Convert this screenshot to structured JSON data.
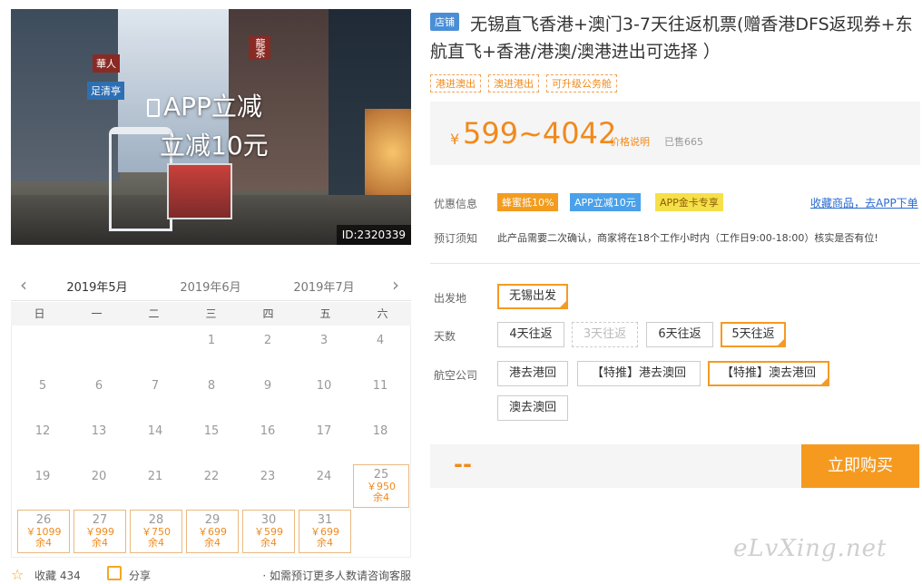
{
  "photo": {
    "overlay_line1": "APP立减",
    "overlay_line2": "立减10元",
    "image_id": "ID:2320339",
    "signs": [
      "足清亭",
      "華人",
      "龍茶"
    ]
  },
  "calendar": {
    "months": [
      "2019年5月",
      "2019年6月",
      "2019年7月"
    ],
    "active_month": "2019年5月",
    "weekdays": [
      "日",
      "一",
      "二",
      "三",
      "四",
      "五",
      "六"
    ],
    "plain_days": [
      "1",
      "2",
      "3",
      "4",
      "5",
      "6",
      "7",
      "8",
      "9",
      "10",
      "11",
      "12",
      "13",
      "14",
      "15",
      "16",
      "17",
      "18",
      "19",
      "20",
      "21",
      "22",
      "23",
      "24"
    ],
    "avail_days": [
      {
        "day": "25",
        "price": "￥950",
        "remain": "余4"
      },
      {
        "day": "26",
        "price": "￥1099",
        "remain": "余4"
      },
      {
        "day": "27",
        "price": "￥999",
        "remain": "余4"
      },
      {
        "day": "28",
        "price": "￥750",
        "remain": "余4"
      },
      {
        "day": "29",
        "price": "￥699",
        "remain": "余4"
      },
      {
        "day": "30",
        "price": "￥599",
        "remain": "余4"
      },
      {
        "day": "31",
        "price": "￥699",
        "remain": "余4"
      }
    ]
  },
  "footer": {
    "favorite_label": "收藏 434",
    "share_label": "分享",
    "tip": "· 如需预订更多人数请咨询客服"
  },
  "product": {
    "shop_tag": "店铺",
    "title": "无锡直飞香港+澳门3-7天往返机票(赠香港DFS返现券+东航直飞+香港/港澳/澳港进出可选择 ）",
    "tags": [
      "港进澳出",
      "澳进港出",
      "可升级公务舱"
    ],
    "price_currency": "¥",
    "price": "599~4042",
    "price_note": "价格说明",
    "sold": "已售665"
  },
  "promo": {
    "label": "优惠信息",
    "items": [
      "蜂蜜抵10%",
      "APP立减10元",
      "APP金卡专享"
    ],
    "fav_link": "收藏商品，去APP下单"
  },
  "notice": {
    "label": "预订须知",
    "text": "此产品需要二次确认，商家将在18个工作小时内（工作日9:00-18:00）核实是否有位!"
  },
  "options": {
    "departure_label": "出发地",
    "departure": [
      "无锡出发"
    ],
    "days_label": "天数",
    "days": [
      "4天往返",
      "3天往返",
      "6天往返",
      "5天往返"
    ],
    "airline_label": "航空公司",
    "airline": [
      "港去港回",
      "【特推】港去澳回",
      "【特推】澳去港回",
      "澳去澳回"
    ]
  },
  "buy": {
    "total": "--",
    "button": "立即购买"
  },
  "watermark": "eLvXing.net",
  "colors": {
    "accent": "#f59a23",
    "price": "#f08a1c",
    "link": "#2a6ad1",
    "shop_tag": "#4a8fd6"
  }
}
